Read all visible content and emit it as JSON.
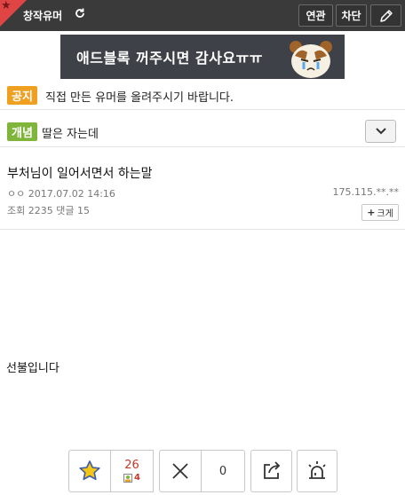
{
  "header": {
    "gallery_title": "창작유머",
    "buttons": {
      "related": "연관",
      "block": "차단"
    }
  },
  "ad": {
    "text": "애드블록 꺼주시면 감사요ㅠㅠ"
  },
  "notice": {
    "badge": "공지",
    "text": "직접 만든 유머를 올려주시기 바랍니다."
  },
  "concept": {
    "badge": "개념",
    "text": "딸은 자는데"
  },
  "post": {
    "title": "부처님이 일어서면서 하는말",
    "author_date": "ㅇㅇ 2017.07.02 14:16",
    "ip": "175.115.**.**",
    "stats": "조회 2235 댓글 15",
    "enlarge_label": "크게",
    "body": "선불입니다"
  },
  "actions": {
    "recommend_count": "26",
    "fixed_recommend_count": "4",
    "nonrecommend_count": "0"
  },
  "colors": {
    "accent_red": "#e04545",
    "notice_badge": "#f0a020",
    "concept_badge": "#7fb53a",
    "topbar": "#3a3a3a"
  }
}
